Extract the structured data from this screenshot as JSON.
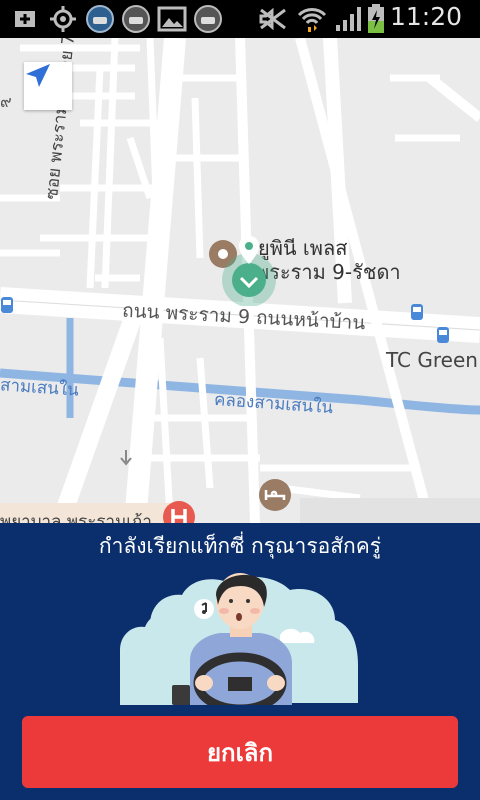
{
  "status_bar": {
    "time": "11:20",
    "icons": [
      "add-icon",
      "gps-icon",
      "taxi-app-icon",
      "taxi-app-icon",
      "image-icon",
      "taxi-app-icon",
      "mute-icon",
      "wifi-icon",
      "signal-icon",
      "battery-charging-icon"
    ]
  },
  "map": {
    "labels": {
      "road_main": "ถนน พระราม 9 ถนนหน้าบ้าน",
      "place_1_line1": "ยูพินี เพลส",
      "place_1_line2": "พระราม 9-รัชดา",
      "tc_green": "TC Green",
      "canal": "คลองสามเสนใน",
      "canal_left": "สามเสนใน",
      "soi_left": "ซอย พระราม 9 ซอย 7",
      "hospital": "พยาบาล พระรามเก้า",
      "edge_number": "๙"
    }
  },
  "panel": {
    "status_text": "กำลังเรียกแท็กซี่ กรุณารอสักครู่",
    "cancel_label": "ยกเลิก"
  },
  "colors": {
    "panel_bg": "#0b2f6d",
    "cancel_bg": "#ec3a3a",
    "marker": "#4caf8c"
  }
}
